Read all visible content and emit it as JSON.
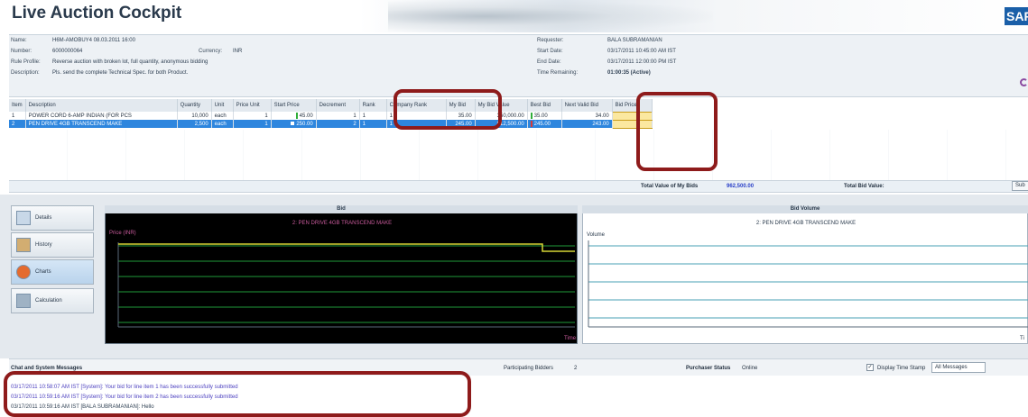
{
  "app": {
    "title": "Live Auction Cockpit",
    "logo": "SAP"
  },
  "header": {
    "name_label": "Name:",
    "name_value": "H6M-AMOBUY4 08.03.2011 16:00",
    "number_label": "Number:",
    "number_value": "6000000064",
    "currency_label": "Currency:",
    "currency_value": "INR",
    "rule_profile_label": "Rule Profile:",
    "rule_profile_value": "Reverse auction with broken lot, full quantity, anonymous bidding",
    "description_label": "Description:",
    "description_value": "Pls. send the complete Technical Spec. for both Product.",
    "requester_label": "Requester:",
    "requester_value": "BALA SUBRAMANIAN",
    "start_label": "Start Date:",
    "start_value": "03/17/2011 10:45:00 AM IST",
    "end_label": "End Date:",
    "end_value": "03/17/2011 12:00:00 PM IST",
    "time_remaining_label": "Time Remaining:",
    "time_remaining_value": "01:00:35 (Active)"
  },
  "table": {
    "columns": [
      "Item",
      "Description",
      "Quantity",
      "Unit",
      "Price Unit",
      "Start Price",
      "Decrement",
      "Rank",
      "Company Rank",
      "My Bid",
      "My Bid Value",
      "Best Bid",
      "Next Valid Bid",
      "Bid Price"
    ],
    "rows": [
      {
        "item": "1",
        "description": "POWER CORD 6-AMP INDIAN (FOR PCS",
        "quantity": "10,000",
        "unit": "each",
        "price_unit": "1",
        "start_price": "45.00",
        "decrement": "1",
        "rank": "1",
        "company_rank": "1",
        "my_bid": "35.00",
        "my_bid_value": "350,000.00",
        "best_bid": "35.00",
        "next_valid_bid": "34.00",
        "bid_price": ""
      },
      {
        "item": "2",
        "description": "PEN DRIVE 4GB TRANSCEND MAKE",
        "quantity": "2,500",
        "unit": "each",
        "price_unit": "1",
        "start_price": "250.00",
        "decrement": "2",
        "rank": "1",
        "company_rank": "1",
        "my_bid": "245.00",
        "my_bid_value": "612,500.00",
        "best_bid": "245.00",
        "next_valid_bid": "243.00",
        "bid_price": ""
      }
    ]
  },
  "totals": {
    "my_bids_label": "Total Value of My Bids",
    "my_bids_value": "962,500.00",
    "total_bid_label": "Total Bid Value:",
    "submit_label": "Sub"
  },
  "nav": {
    "details": "Details",
    "history": "History",
    "charts": "Charts",
    "calculation": "Calculation"
  },
  "bid_chart": {
    "header": "Bid",
    "subtitle": "2: PEN DRIVE 4GB TRANSCEND MAKE",
    "ylabel": "Price (INR)",
    "xlabel": "Time"
  },
  "volume_chart": {
    "header": "Bid Volume",
    "subtitle": "2: PEN DRIVE 4GB TRANSCEND MAKE",
    "ylabel": "Volume",
    "xlabel": "Ti"
  },
  "status": {
    "chat_label": "Chat and System Messages",
    "participating_label": "Participating Bidders",
    "participating_value": "2",
    "purchaser_label": "Purchaser Status",
    "purchaser_value": "Online",
    "timestamp_label": "Display Time Stamp",
    "filter_value": "All Messages"
  },
  "messages": [
    "03/17/2011 10:58:07 AM IST [System]:  Your bid for line item 1 has been successfully submitted",
    "03/17/2011 10:59:16 AM IST [System]:  Your bid for line item 2 has been successfully submitted",
    "03/17/2011 10:59:16 AM IST [BALA SUBRAMANIAN]: Hello"
  ],
  "colors": {
    "selection": "#2e86de",
    "highlight": "#8e1b1b",
    "chart_line": "#d6d635",
    "chart_grid": "#1f9a3a"
  }
}
